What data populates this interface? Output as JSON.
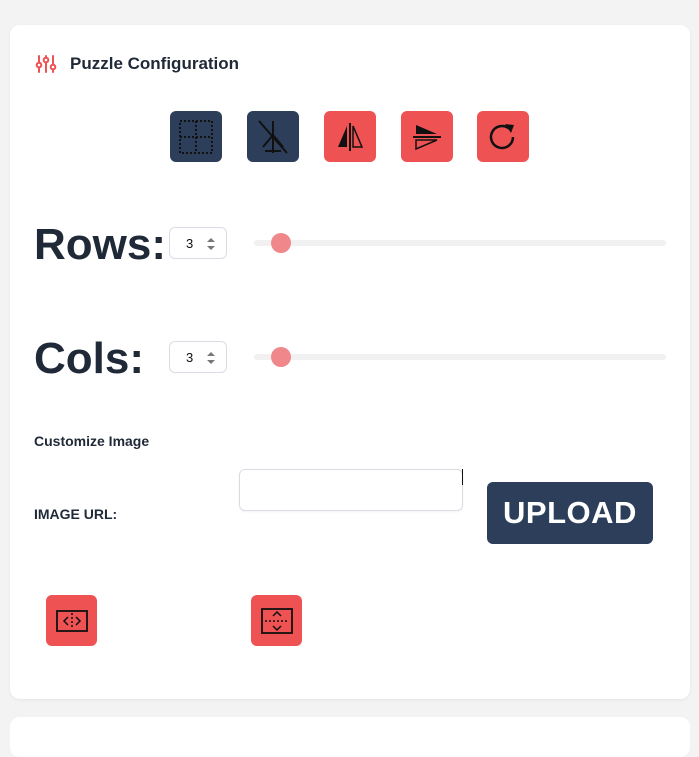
{
  "config": {
    "title": "Puzzle Configuration",
    "title_icon": "sliders-icon",
    "accent_color": "#ee5253",
    "dark_color": "#2c3e5a"
  },
  "toolbar": {
    "buttons": [
      {
        "name": "grid-toggle",
        "icon": "dotted-grid-icon",
        "style": "dark"
      },
      {
        "name": "no-shape",
        "icon": "crossed-tree-icon",
        "style": "dark"
      },
      {
        "name": "flip-horizontal",
        "icon": "flip-horizontal-icon",
        "style": "red"
      },
      {
        "name": "flip-vertical",
        "icon": "flip-vertical-icon",
        "style": "red"
      },
      {
        "name": "rotate",
        "icon": "rotate-icon",
        "style": "red"
      }
    ]
  },
  "rows": {
    "label": "Rows:",
    "value": "3",
    "slider_fraction": 0.0
  },
  "cols": {
    "label": "Cols:",
    "value": "3",
    "slider_fraction": 0.0
  },
  "image": {
    "section_label": "Customize Image",
    "url_label": "IMAGE URL:",
    "url_value": "",
    "upload_label": "UPLOAD"
  },
  "split": {
    "buttons": [
      {
        "name": "split-horizontal",
        "icon": "split-horizontal-icon"
      },
      {
        "name": "split-vertical",
        "icon": "split-vertical-icon"
      }
    ]
  }
}
